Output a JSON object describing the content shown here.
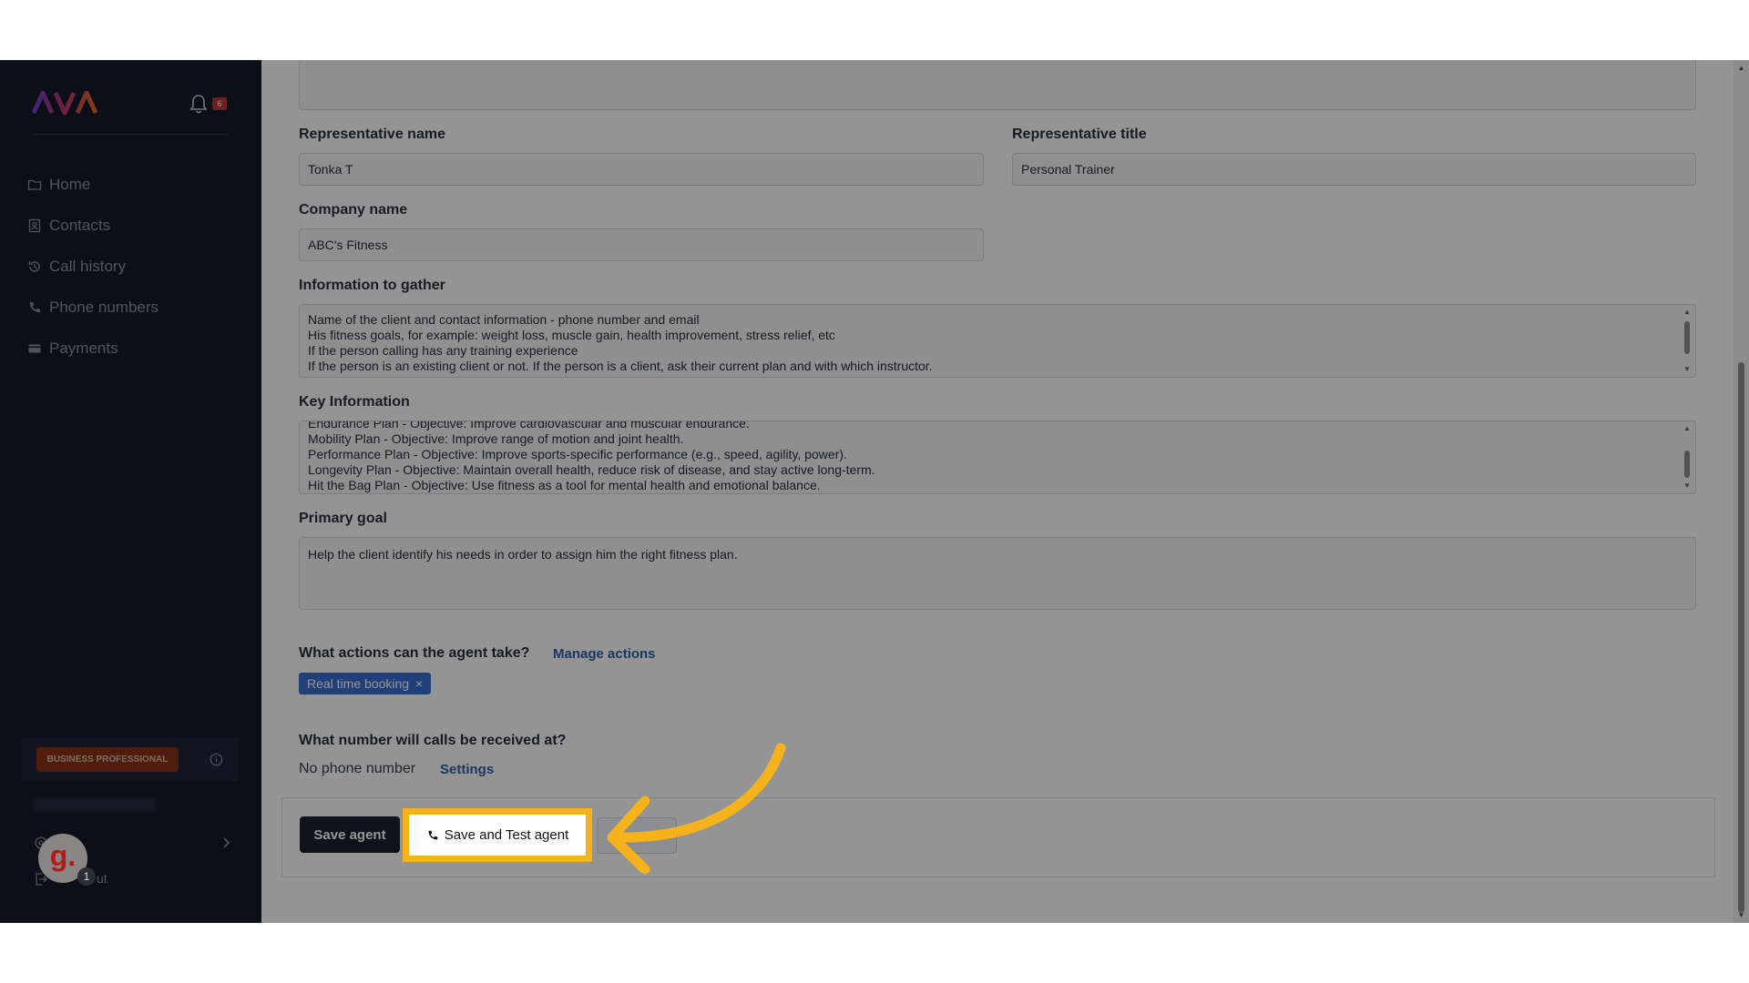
{
  "sidebar": {
    "logo_text": "AVA",
    "notification_count": "6",
    "nav": [
      {
        "label": "Home",
        "icon": "folder-icon"
      },
      {
        "label": "Contacts",
        "icon": "contact-card-icon"
      },
      {
        "label": "Call history",
        "icon": "history-icon"
      },
      {
        "label": "Phone numbers",
        "icon": "phone-icon"
      },
      {
        "label": "Payments",
        "icon": "card-icon"
      }
    ],
    "plan_badge": "BUSINESS PROFESSIONAL",
    "logout_fragment": "ut",
    "avatar_letter": "g.",
    "avatar_count": "1"
  },
  "form": {
    "rep_name_label": "Representative name",
    "rep_name_value": "Tonka T",
    "rep_title_label": "Representative title",
    "rep_title_value": "Personal Trainer",
    "company_label": "Company name",
    "company_value": "ABC's Fitness",
    "info_gather_label": "Information to gather",
    "info_gather_lines": [
      "Name of the client and contact information - phone number and email",
      "His fitness goals, for example: weight loss, muscle gain, health improvement, stress relief, etc",
      "If the person calling has any training experience",
      "If the person is an existing client or not. If the person is a client, ask their current plan and with which instructor."
    ],
    "key_info_label": "Key Information",
    "key_info_lines": [
      "Endurance Plan - Objective: Improve cardiovascular and muscular endurance.",
      "Mobility Plan - Objective: Improve range of motion and joint health.",
      "Performance Plan - Objective: Improve sports-specific performance (e.g., speed, agility, power).",
      "Longevity Plan - Objective: Maintain overall health, reduce risk of disease, and stay active long-term.",
      "Hit the Bag Plan - Objective: Use fitness as a tool for mental health and emotional balance."
    ],
    "primary_goal_label": "Primary goal",
    "primary_goal_value": "Help the client identify his needs in order to assign him the right fitness plan.",
    "actions_label": "What actions can the agent take?",
    "manage_actions": "Manage actions",
    "action_chip": "Real time booking",
    "chip_remove": "×",
    "number_label": "What number will calls be received at?",
    "no_phone": "No phone number",
    "settings_link": "Settings"
  },
  "footer": {
    "save_label": "Save agent",
    "save_test_label": "Save and Test agent"
  },
  "colors": {
    "highlight": "#f6b21b",
    "sidebar_bg": "#171b2a",
    "accent_blue": "#3a6dd0",
    "plan_badge": "#8a3318"
  }
}
